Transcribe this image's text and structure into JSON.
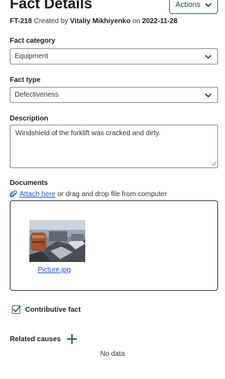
{
  "header": {
    "title": "Fact Details",
    "actions_label": "Actions"
  },
  "meta": {
    "id": "FT-218",
    "created_by_label": "Created by",
    "author": "Vitaliy Mikhiyenko",
    "on_label": "on",
    "date": "2022-11-28"
  },
  "fact_category": {
    "label": "Fact category",
    "value": "Equipment"
  },
  "fact_type": {
    "label": "Fact type",
    "value": "Defectiveness"
  },
  "description": {
    "label": "Description",
    "value": "Windshield of the forklift was cracked and dirty."
  },
  "documents": {
    "label": "Documents",
    "attach_link": "Attach here",
    "attach_hint": "or drag and drop file from computer",
    "files": [
      {
        "name": "Picture.jpg",
        "icon": "image-thumbnail"
      }
    ]
  },
  "contributive": {
    "label": "Contributive fact",
    "checked": true
  },
  "related_causes": {
    "label": "Related causes",
    "empty_text": "No data"
  },
  "colors": {
    "accent": "#2f6f67",
    "link": "#1a55c9"
  }
}
